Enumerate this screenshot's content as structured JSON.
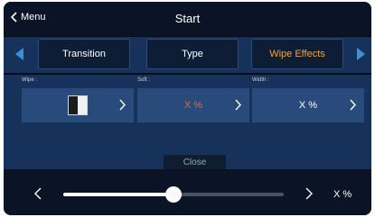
{
  "header": {
    "menu_label": "Menu",
    "title": "Start"
  },
  "tabs": [
    {
      "label": "Transition",
      "active": false
    },
    {
      "label": "Type",
      "active": false
    },
    {
      "label": "Wipe Effects",
      "active": true
    }
  ],
  "params": {
    "wipe": {
      "label": "Wipe :",
      "icon": "wipe-pattern-icon"
    },
    "soft": {
      "label": "Soft :",
      "value": "X %"
    },
    "width": {
      "label": "Width :",
      "value": "X %"
    }
  },
  "close_label": "Close",
  "slider": {
    "value_text": "X %",
    "position_fraction": 0.5
  },
  "colors": {
    "accent": "#f5a623",
    "soft_value": "#e4683a",
    "arrow": "#3f8fd8",
    "panel": "#17325a",
    "box": "#284b7c"
  }
}
